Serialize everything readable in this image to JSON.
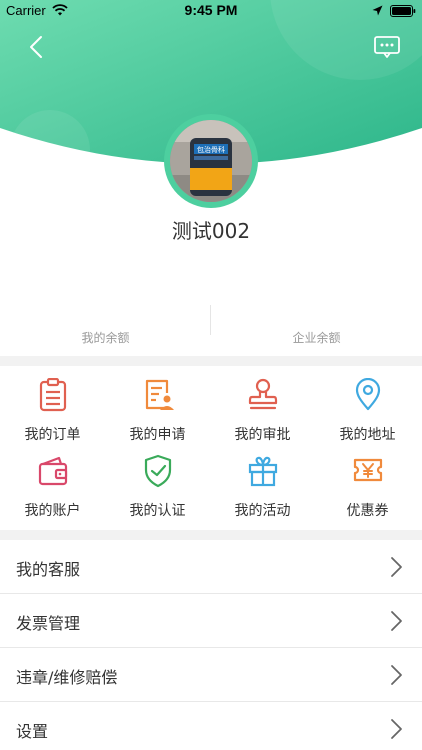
{
  "status_bar": {
    "carrier": "Carrier",
    "time": "9:45 PM"
  },
  "header": {
    "gradient_from": "#62d8a8",
    "gradient_to": "#2ebf8e",
    "back_icon": "chevron-left-icon",
    "message_icon": "message-dots-icon"
  },
  "profile": {
    "username": "测试002",
    "avatar_sign_text": "包治骨科"
  },
  "balances": {
    "personal_label": "我的余额",
    "enterprise_label": "企业余额"
  },
  "grid": [
    {
      "label": "我的订单",
      "icon": "clipboard-list-icon",
      "color": "#e06050"
    },
    {
      "label": "我的申请",
      "icon": "form-user-icon",
      "color": "#f08a3c"
    },
    {
      "label": "我的审批",
      "icon": "stamp-icon",
      "color": "#e06050"
    },
    {
      "label": "我的地址",
      "icon": "location-pin-icon",
      "color": "#3fa9e0"
    },
    {
      "label": "我的账户",
      "icon": "wallet-icon",
      "color": "#d9486a"
    },
    {
      "label": "我的认证",
      "icon": "shield-check-icon",
      "color": "#3aaa5a"
    },
    {
      "label": "我的活动",
      "icon": "gift-icon",
      "color": "#3fa9e0"
    },
    {
      "label": "优惠券",
      "icon": "coupon-yen-icon",
      "color": "#f08a3c"
    }
  ],
  "list": [
    {
      "label": "我的客服"
    },
    {
      "label": "发票管理"
    },
    {
      "label": "违章/维修赔偿"
    },
    {
      "label": "设置"
    }
  ]
}
